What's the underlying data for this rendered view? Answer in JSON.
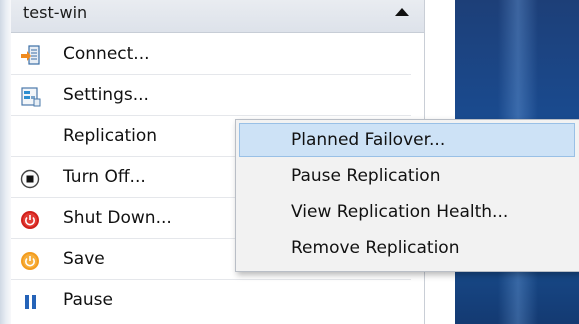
{
  "vm_panel": {
    "title": "test-win",
    "items": [
      {
        "label": "Connect...",
        "icon": "connect-icon"
      },
      {
        "label": "Settings...",
        "icon": "settings-icon"
      },
      {
        "label": "Replication",
        "icon": ""
      },
      {
        "label": "Turn Off...",
        "icon": "turn-off-icon"
      },
      {
        "label": "Shut Down...",
        "icon": "shut-down-icon"
      },
      {
        "label": "Save",
        "icon": "save-icon"
      },
      {
        "label": "Pause",
        "icon": "pause-icon"
      }
    ]
  },
  "replication_submenu": {
    "items": [
      {
        "label": "Planned Failover...",
        "highlighted": true
      },
      {
        "label": "Pause Replication",
        "highlighted": false
      },
      {
        "label": "View Replication Health...",
        "highlighted": false
      },
      {
        "label": "Remove Replication",
        "highlighted": false
      }
    ]
  },
  "colors": {
    "highlight": "#cde2f6",
    "shut_down_red": "#d0201b",
    "save_orange": "#f39c1e",
    "pause_blue": "#2563b8",
    "desktop_blue": "#1a4a8e"
  }
}
